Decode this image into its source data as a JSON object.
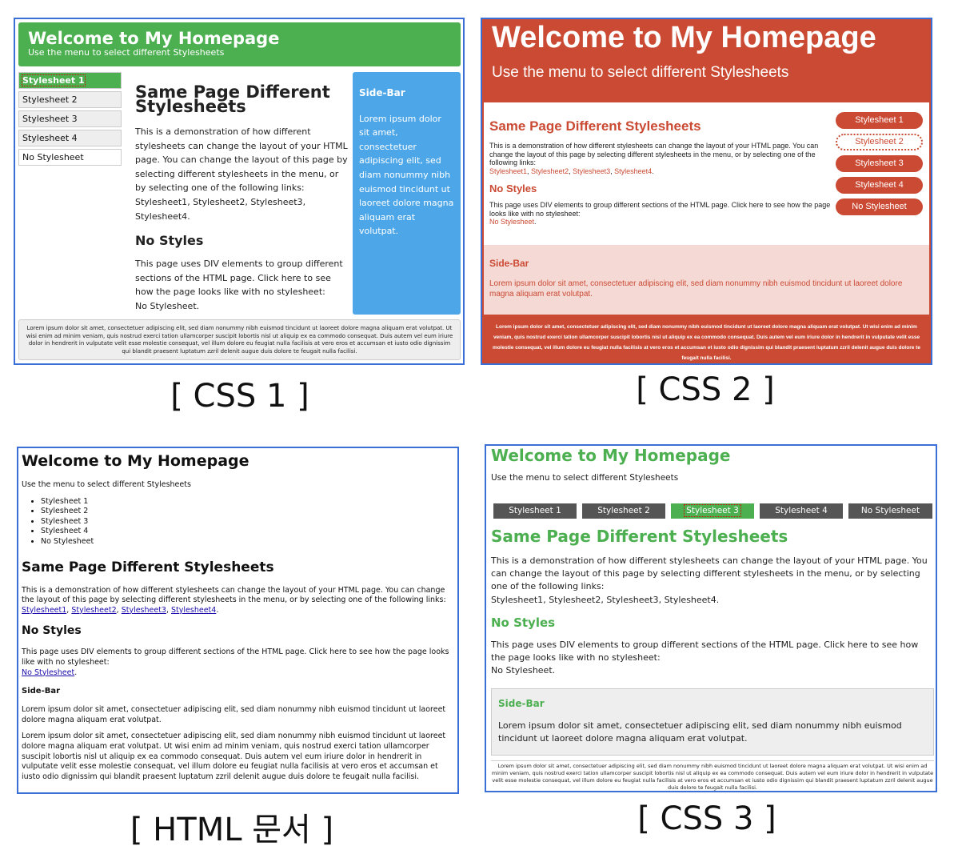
{
  "site": {
    "title": "Welcome to My Homepage",
    "subtitle": "Use the menu to select different Stylesheets"
  },
  "menu": [
    "Stylesheet 1",
    "Stylesheet 2",
    "Stylesheet 3",
    "Stylesheet 4",
    "No Stylesheet"
  ],
  "content": {
    "heading": "Same Page Different Stylesheets",
    "intro": "This is a demonstration of how different stylesheets can change the layout of your HTML page. You can change the layout of this page by selecting different stylesheets in the menu, or by selecting one of the following links:",
    "links": [
      "Stylesheet1",
      "Stylesheet2",
      "Stylesheet3",
      "Stylesheet4"
    ],
    "no_styles_heading": "No Styles",
    "no_styles_text": "This page uses DIV elements to group different sections of the HTML page. Click here to see how the page looks like with no stylesheet:",
    "no_stylesheet_link": "No Stylesheet"
  },
  "sidebar": {
    "heading": "Side-Bar",
    "text": "Lorem ipsum dolor sit amet, consectetuer adipiscing elit, sed diam nonummy nibh euismod tincidunt ut laoreet dolore magna aliquam erat volutpat."
  },
  "footer": {
    "text": "Lorem ipsum dolor sit amet, consectetuer adipiscing elit, sed diam nonummy nibh euismod tincidunt ut laoreet dolore magna aliquam erat volutpat. Ut wisi enim ad minim veniam, quis nostrud exerci tation ullamcorper suscipit lobortis nisl ut aliquip ex ea commodo consequat. Duis autem vel eum iriure dolor in hendrerit in vulputate velit esse molestie consequat, vel illum dolore eu feugiat nulla facilisis at vero eros et accumsan et iusto odio dignissim qui blandit praesent luptatum zzril delenit augue duis dolore te feugait nulla facilisi."
  },
  "captions": {
    "css1": "[ CSS 1 ]",
    "css2": "[ CSS 2 ]",
    "html": "[ HTML 문서 ]",
    "css3": "[ CSS 3 ]"
  },
  "colors": {
    "css1_green": "#4caf50",
    "css1_blue": "#4ca6e8",
    "css2_red": "#cb4a33",
    "css2_pink": "#f5d9d5",
    "css3_green": "#4caf50",
    "css3_menu": "#555555",
    "panel_border": "#3a6fd8",
    "html_link": "#1a0dab"
  }
}
